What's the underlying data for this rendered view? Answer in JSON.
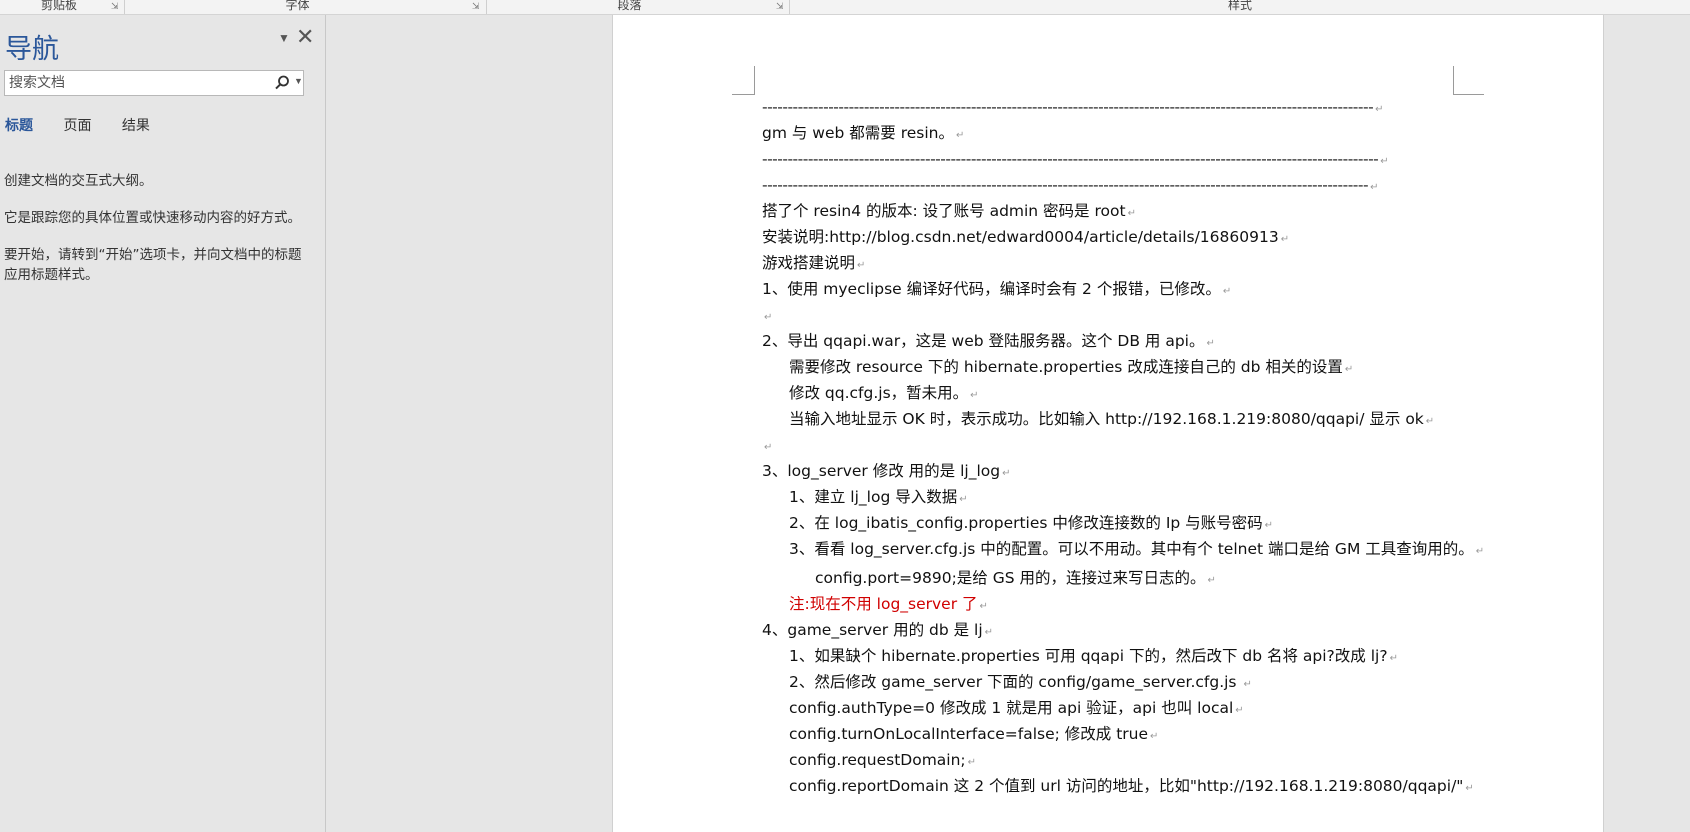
{
  "ribbon": {
    "groups": [
      "剪贴板",
      "字体",
      "段落",
      "样式"
    ]
  },
  "nav": {
    "title": "导航",
    "search_placeholder": "搜索文档",
    "tabs": [
      "标题",
      "页面",
      "结果"
    ],
    "active_tab": "标题",
    "help": [
      "创建文档的交互式大纲。",
      "它是跟踪您的具体位置或快速移动内容的好方式。",
      "要开始，请转到“开始”选项卡，并向文档中的标题应用标题样式。"
    ]
  },
  "document": {
    "paragraph_mark": "↵",
    "lines": [
      "------------------------------------------------------------------------------------------------------------------------",
      "gm 与 web 都需要 resin。",
      "-------------------------------------------------------------------------------------------------------------------------",
      "-----------------------------------------------------------------------------------------------------------------------",
      "搭了个 resin4 的版本:  设了账号 admin 密码是 root",
      "安装说明:http://blog.csdn.net/edward0004/article/details/16860913",
      "游戏搭建说明",
      "1、使用 myeclipse 编译好代码，编译时会有 2 个报错，已修改。",
      "",
      "2、导出 qqapi.war，这是 web 登陆服务器。这个 DB 用 api。",
      "需要修改  resource 下的  hibernate.properties  改成连接自己的 db 相关的设置",
      "修改 qq.cfg.js，暂未用。",
      "当输入地址显示 OK 时，表示成功。比如输入 http://192.168.1.219:8080/qqapi/  显示 ok",
      "",
      "3、log_server  修改  用的是 lj_log",
      "1、建立 lj_log 导入数据",
      "2、在 log_ibatis_config.properties 中修改连接数的 Ip 与账号密码",
      "3、看看 log_server.cfg.js 中的配置。可以不用动。其中有个 telnet 端口是给 GM 工具查询用的。",
      "config.port=9890;是给 GS 用的，连接过来写日志的。",
      "注:现在不用 log_server 了",
      "4、game_server      用的 db 是 lj",
      "1、如果缺个 hibernate.properties  可用 qqapi 下的，然后改下 db 名将 api?改成 lj?",
      "2、然后修改 game_server 下面的 config/game_server.cfg.js ",
      "config.authType=0  修改成 1  就是用 api 验证，api 也叫 local",
      "config.turnOnLocalInterface=false;  修改成 true",
      "config.requestDomain;",
      "config.reportDomain  这 2 个值到 url 访问的地址，比如\"http://192.168.1.219:8080/qqapi/\""
    ]
  }
}
